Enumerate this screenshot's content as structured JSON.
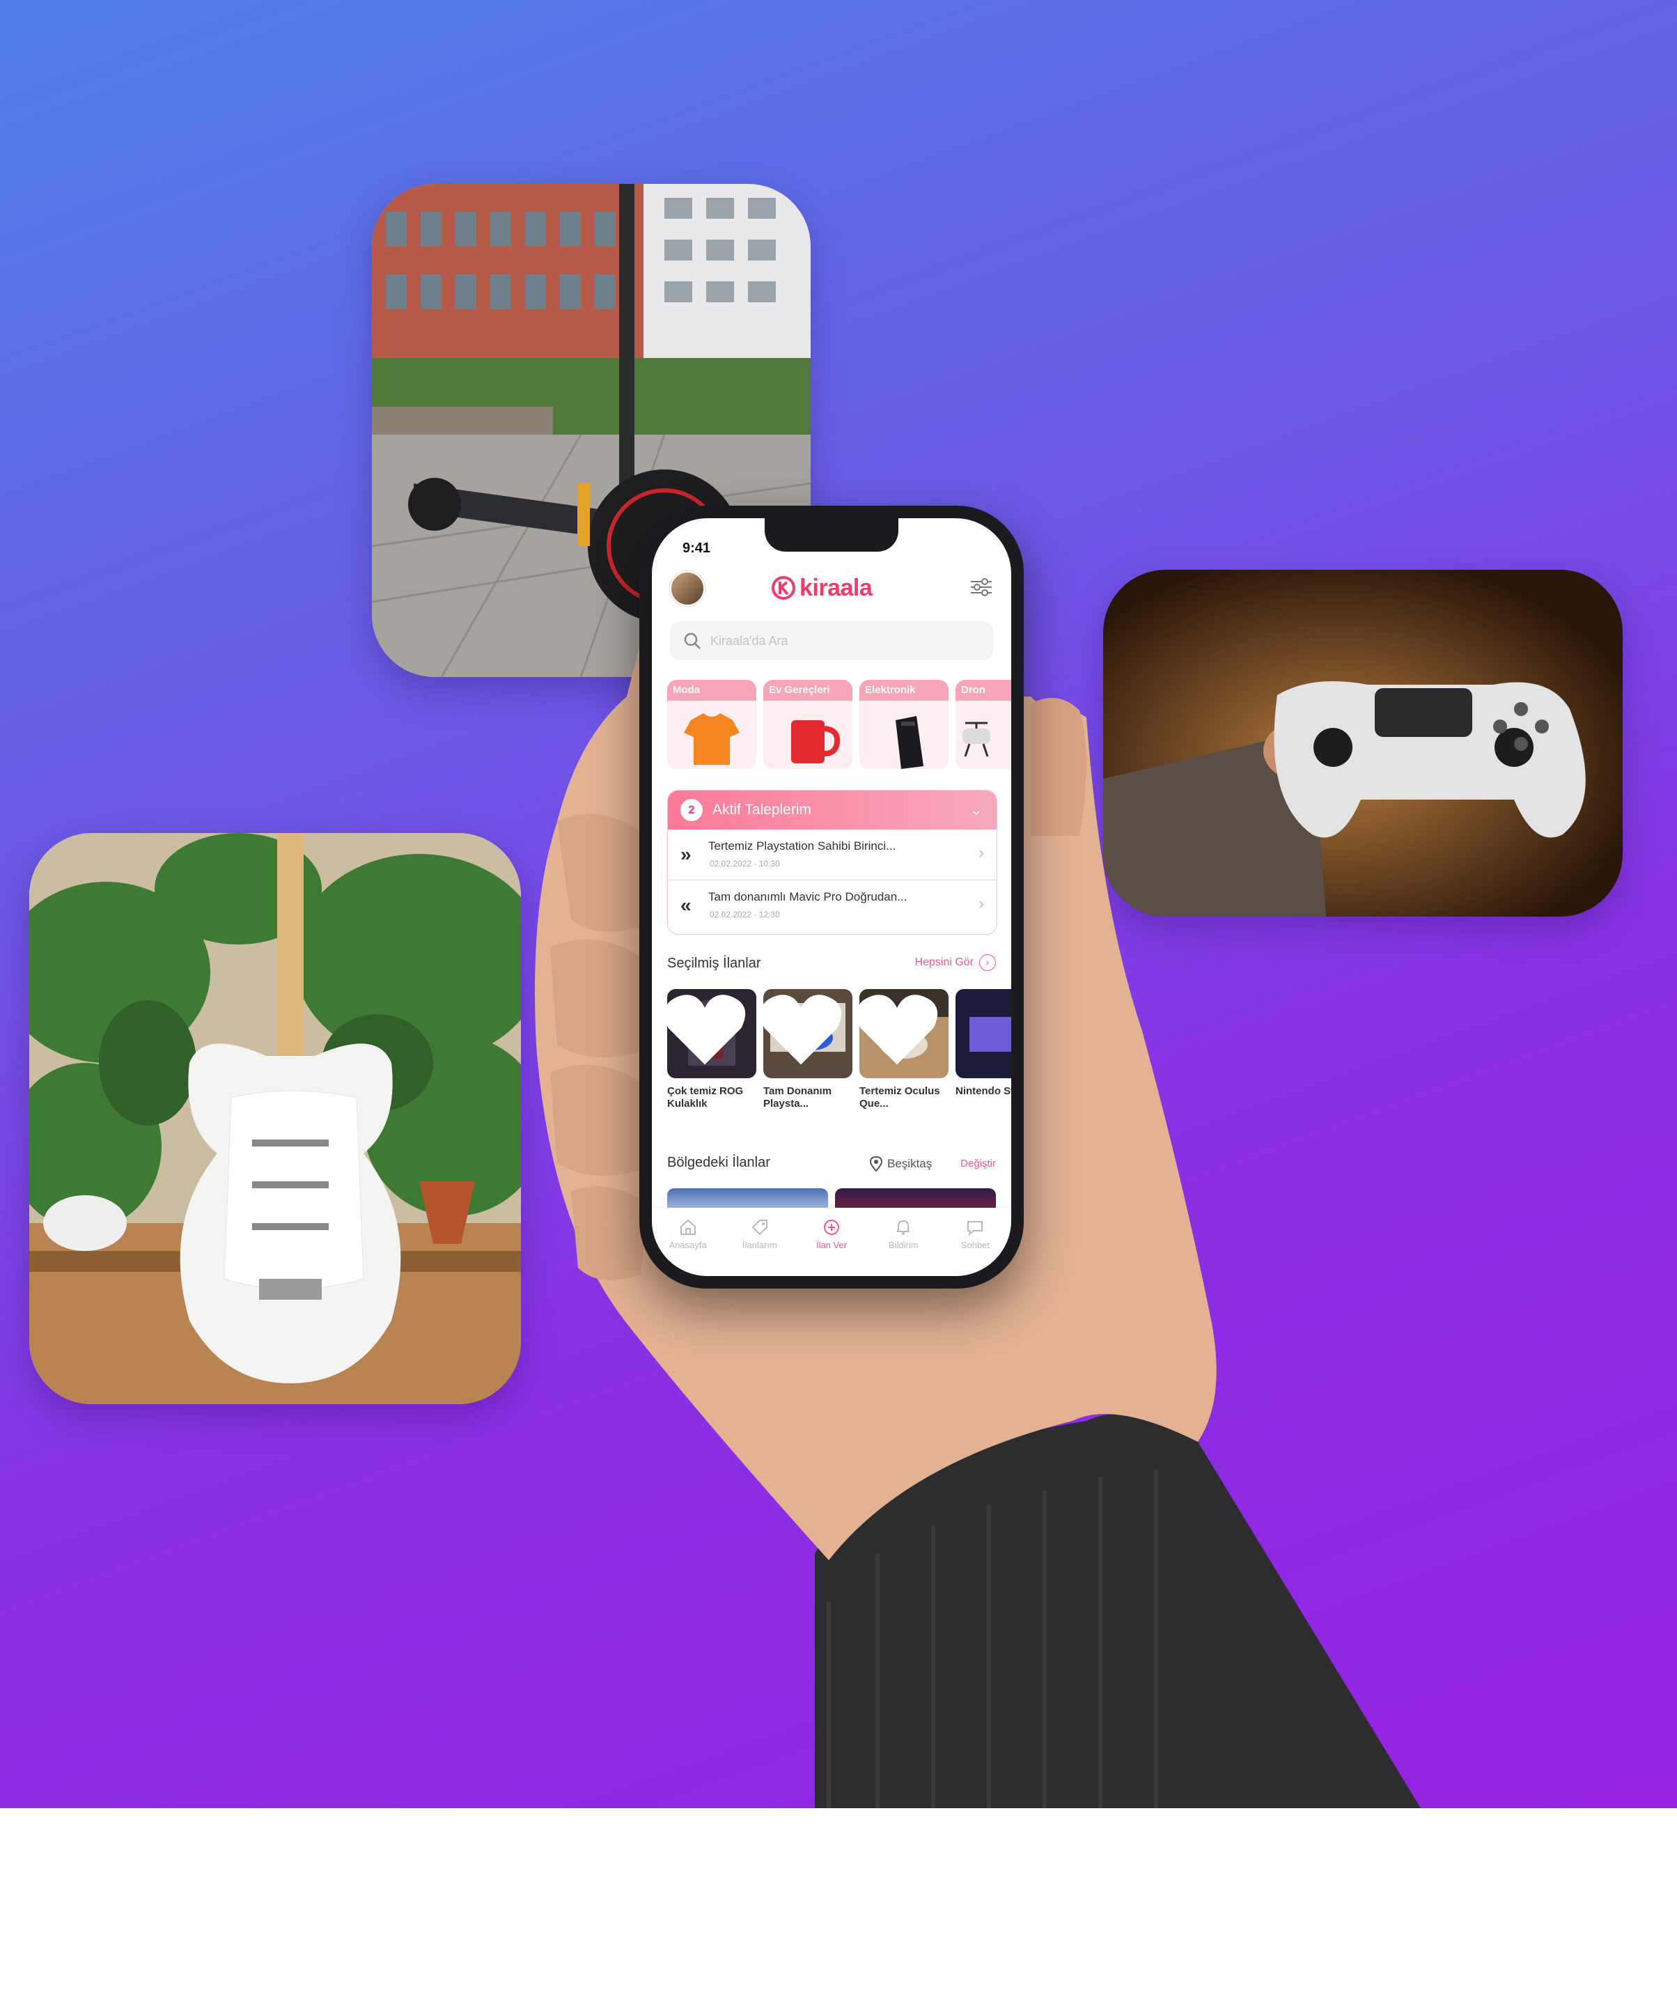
{
  "status_bar": {
    "time": "9:41"
  },
  "header": {
    "logo_text": "kiraala"
  },
  "search": {
    "placeholder": "Kiraala'da Ara"
  },
  "categories": [
    {
      "label": "Moda",
      "icon": "tshirt-icon"
    },
    {
      "label": "Ev Gereçleri",
      "icon": "mug-icon"
    },
    {
      "label": "Elektronik",
      "icon": "phone-icon"
    },
    {
      "label": "Dron",
      "icon": "drone-icon"
    }
  ],
  "active_requests": {
    "count": "2",
    "title": "Aktif Taleplerim",
    "items": [
      {
        "name": "Tertemiz Playstation Sahibi Birinci...",
        "meta": "02.02.2022 · 10:30",
        "icon": "double-chevron-right-icon"
      },
      {
        "name": "Tam donanımlı Mavic Pro Doğrudan...",
        "meta": "02.02.2022 · 12:30",
        "icon": "double-chevron-left-icon"
      }
    ]
  },
  "featured": {
    "title": "Seçilmiş İlanlar",
    "see_all": "Hepsini Gör",
    "items": [
      {
        "name": "Çok temiz ROG Kulaklık"
      },
      {
        "name": "Tam Donanım Playsta..."
      },
      {
        "name": "Tertemiz Oculus Que..."
      },
      {
        "name": "Nintendo Switch"
      }
    ]
  },
  "regional": {
    "title": "Bölgedeki İlanlar",
    "location": "Beşiktaş",
    "change": "Değiştir"
  },
  "tabbar": [
    {
      "label": "Anasayfa",
      "icon": "home-icon"
    },
    {
      "label": "İlanlarım",
      "icon": "tag-icon"
    },
    {
      "label": "İlan Ver",
      "icon": "plus-circle-icon",
      "active": true
    },
    {
      "label": "Bildirim",
      "icon": "bell-icon"
    },
    {
      "label": "Sohbet",
      "icon": "chat-icon"
    }
  ],
  "colors": {
    "brand": "#ef3d6b",
    "accent_soft": "#f8a6b7",
    "bg_top": "#4f7fe6",
    "bg_bottom": "#9622e2"
  }
}
